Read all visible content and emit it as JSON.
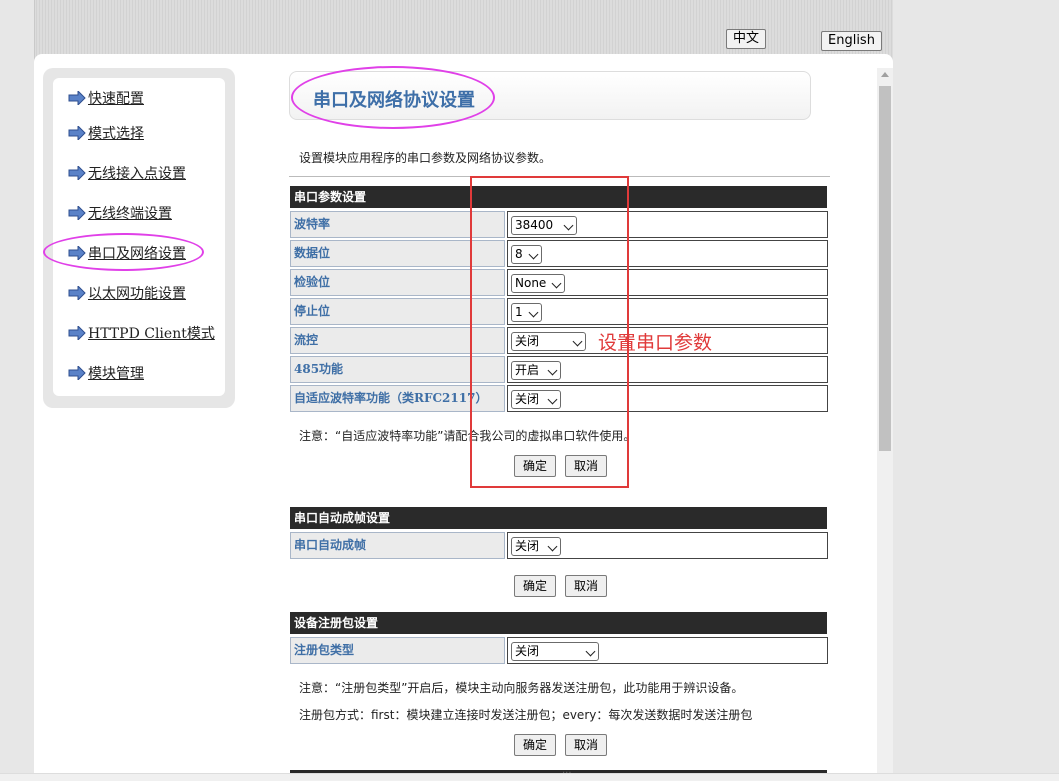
{
  "lang_buttons": {
    "chinese": "中文",
    "english": "English"
  },
  "sidebar": {
    "items": [
      {
        "label": "快速配置"
      },
      {
        "label": "模式选择"
      },
      {
        "label": "无线接入点设置"
      },
      {
        "label": "无线终端设置"
      },
      {
        "label": "串口及网络设置"
      },
      {
        "label": "以太网功能设置"
      },
      {
        "label": "HTTPD Client模式"
      },
      {
        "label": "模块管理"
      }
    ]
  },
  "page": {
    "title": "串口及网络协议设置",
    "description": "设置模块应用程序的串口参数及网络协议参数。"
  },
  "serial_section": {
    "header": "串口参数设置",
    "rows": [
      {
        "label": "波特率",
        "value": "38400"
      },
      {
        "label": "数据位",
        "value": "8"
      },
      {
        "label": "检验位",
        "value": "None"
      },
      {
        "label": "停止位",
        "value": "1"
      },
      {
        "label": "流控",
        "value": "关闭"
      },
      {
        "label": "485功能",
        "value": "开启"
      },
      {
        "label": "自适应波特率功能（类RFC2117）",
        "value": "关闭"
      }
    ],
    "note": "注意：“自适应波特率功能”请配合我公司的虚拟串口软件使用。",
    "ok": "确定",
    "cancel": "取消"
  },
  "annotation": {
    "label": "设置串口参数",
    "color": "#e03a3a"
  },
  "frame_section": {
    "header": "串口自动成帧设置",
    "rows": [
      {
        "label": "串口自动成帧",
        "value": "关闭"
      }
    ],
    "ok": "确定",
    "cancel": "取消"
  },
  "register_section": {
    "header": "设备注册包设置",
    "rows": [
      {
        "label": "注册包类型",
        "value": "关闭"
      }
    ],
    "note1": "注意：“注册包类型”开启后，模块主动向服务器发送注册包，此功能用于辨识设备。",
    "note2": "注册包方式：first：模块建立连接时发送注册包；every：每次发送数据时发送注册包",
    "ok": "确定",
    "cancel": "取消"
  },
  "colors": {
    "accent": "#3e6fa8",
    "highlight": "#e040e8",
    "annotation_red": "#e03a3a",
    "header_bg": "#2a2a2a"
  }
}
